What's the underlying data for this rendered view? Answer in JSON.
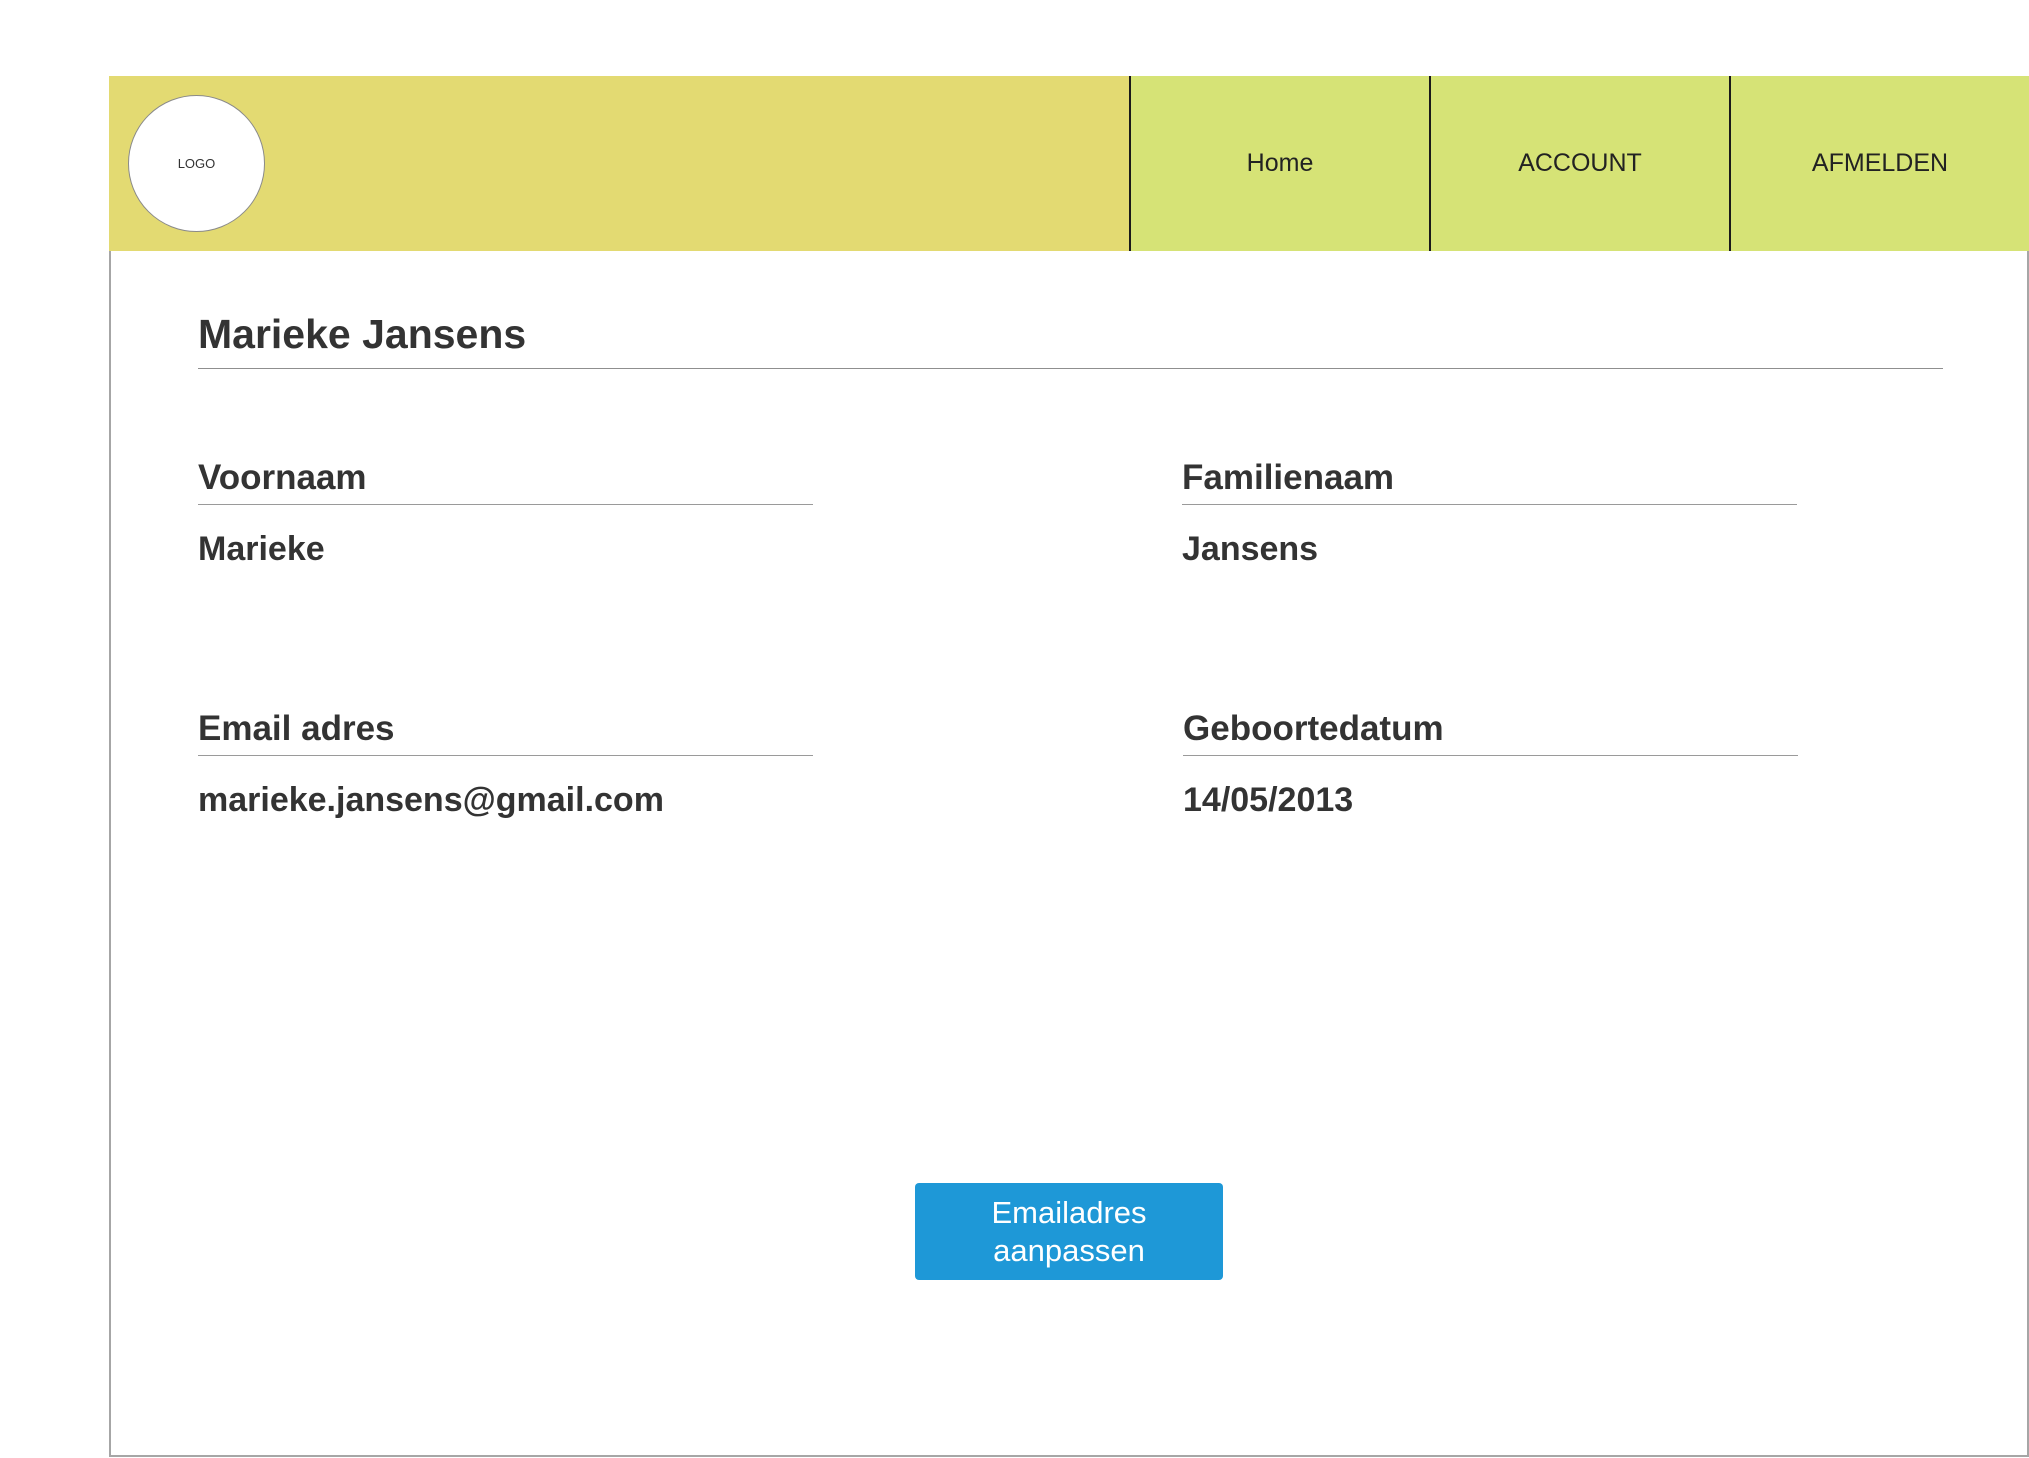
{
  "header": {
    "logo_text": "LOGO",
    "nav": [
      {
        "label": "Home"
      },
      {
        "label": "ACCOUNT"
      },
      {
        "label": "AFMELDEN"
      }
    ]
  },
  "profile": {
    "name": "Marieke Jansens",
    "fields": {
      "first_name": {
        "label": "Voornaam",
        "value": "Marieke"
      },
      "last_name": {
        "label": "Familienaam",
        "value": "Jansens"
      },
      "email": {
        "label": "Email adres",
        "value": "marieke.jansens@gmail.com"
      },
      "birthdate": {
        "label": "Geboortedatum",
        "value": "14/05/2013"
      }
    }
  },
  "actions": {
    "edit_email_label": "Emailadres aanpassen"
  },
  "colors": {
    "brand_bar": "#e3da72",
    "nav_bar": "#d6e376",
    "button": "#1e98d7"
  }
}
